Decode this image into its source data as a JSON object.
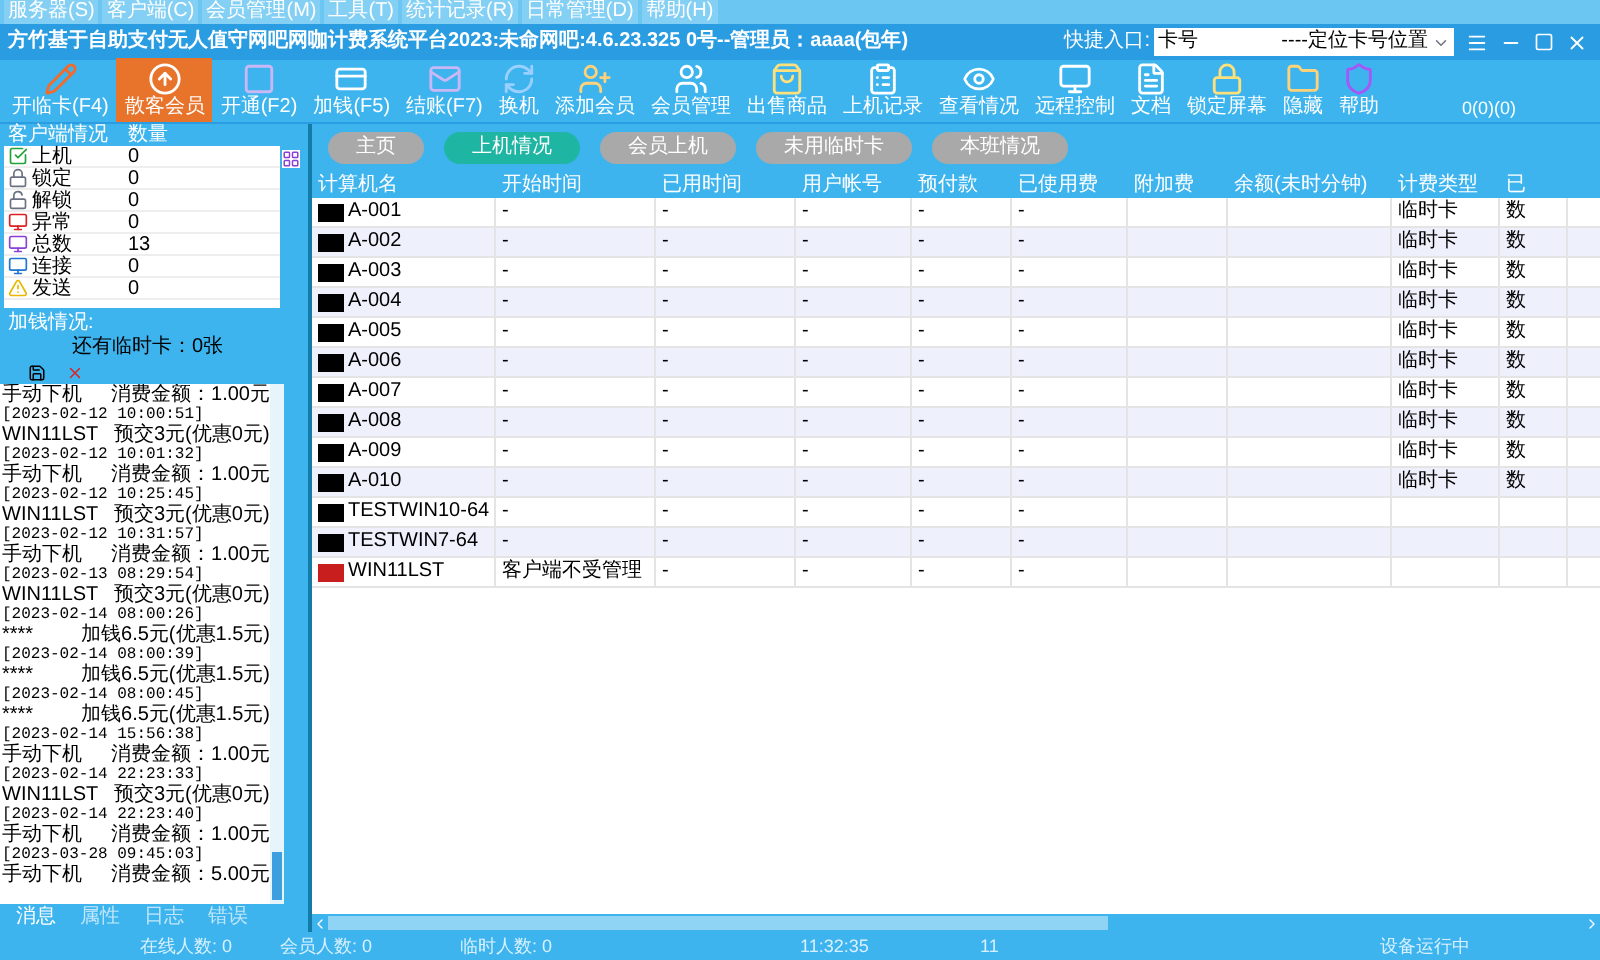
{
  "menu": [
    "服务器(S)",
    "客户端(C)",
    "会员管理(M)",
    "工具(T)",
    "统计记录(R)",
    "日常管理(D)",
    "帮助(H)"
  ],
  "window": {
    "title": "方竹基于自助支付无人值守网吧网咖计费系统平台2023:未命网吧:4.6.23.325 0号--管理员：aaaa(包年)"
  },
  "quick_entry": {
    "label": "快捷入口:",
    "value": "卡号",
    "option": "----定位卡号位置"
  },
  "toolbar": [
    {
      "label": "开临卡(F4)",
      "selected": false
    },
    {
      "label": "散客会员",
      "selected": true
    },
    {
      "label": "开通(F2)",
      "selected": false
    },
    {
      "label": "加钱(F5)",
      "selected": false
    },
    {
      "label": "结账(F7)",
      "selected": false
    },
    {
      "label": "换机",
      "selected": false
    },
    {
      "label": "添加会员",
      "selected": false
    },
    {
      "label": "会员管理",
      "selected": false
    },
    {
      "label": "出售商品",
      "selected": false
    },
    {
      "label": "上机记录",
      "selected": false
    },
    {
      "label": "查看情况",
      "selected": false
    },
    {
      "label": "远程控制",
      "selected": false
    },
    {
      "label": "文档",
      "selected": false
    },
    {
      "label": "锁定屏幕",
      "selected": false
    },
    {
      "label": "隐藏",
      "selected": false
    },
    {
      "label": "帮助",
      "selected": false
    }
  ],
  "toolbar_counter": "0(0)(0)",
  "client_status": {
    "columns": [
      "客户端情况",
      "数量"
    ],
    "rows": [
      {
        "kind": "online",
        "label": "上机",
        "count": "0"
      },
      {
        "kind": "locked",
        "label": "锁定",
        "count": "0"
      },
      {
        "kind": "unlocked",
        "label": "解锁",
        "count": "0"
      },
      {
        "kind": "error",
        "label": "异常",
        "count": "0"
      },
      {
        "kind": "total",
        "label": "总数",
        "count": "13"
      },
      {
        "kind": "connected",
        "label": "连接",
        "count": "0"
      },
      {
        "kind": "sent",
        "label": "发送",
        "count": "0"
      }
    ]
  },
  "topup_label": "加钱情况:",
  "temp_cards": "还有临时卡：0张",
  "log": [
    {
      "source": "手动下机",
      "message": "消费金额：1.00元"
    },
    {
      "time": "[2023-02-12 10:00:51]",
      "source": "WIN11LST",
      "message": "预交3元(优惠0元)"
    },
    {
      "time": "[2023-02-12 10:01:32]",
      "source": "手动下机",
      "message": "消费金额：1.00元"
    },
    {
      "time": "[2023-02-12 10:25:45]",
      "source": "WIN11LST",
      "message": "预交3元(优惠0元)"
    },
    {
      "time": "[2023-02-12 10:31:57]",
      "source": "手动下机",
      "message": "消费金额：1.00元"
    },
    {
      "time": "[2023-02-13 08:29:54]",
      "source": "WIN11LST",
      "message": "预交3元(优惠0元)"
    },
    {
      "time": "[2023-02-14 08:00:26]",
      "source": "****",
      "message": "加钱6.5元(优惠1.5元)"
    },
    {
      "time": "[2023-02-14 08:00:39]",
      "source": "****",
      "message": "加钱6.5元(优惠1.5元)"
    },
    {
      "time": "[2023-02-14 08:00:45]",
      "source": "****",
      "message": "加钱6.5元(优惠1.5元)"
    },
    {
      "time": "[2023-02-14 15:56:38]",
      "source": "手动下机",
      "message": "消费金额：1.00元"
    },
    {
      "time": "[2023-02-14 22:23:33]",
      "source": "WIN11LST",
      "message": "预交3元(优惠0元)"
    },
    {
      "time": "[2023-02-14 22:23:40]",
      "source": "手动下机",
      "message": "消费金额：1.00元"
    },
    {
      "time": "[2023-03-28 09:45:03]",
      "source": "手动下机",
      "message": "消费金额：5.00元"
    }
  ],
  "log_tabs": [
    {
      "label": "消息",
      "selected": true
    },
    {
      "label": "属性",
      "selected": false
    },
    {
      "label": "日志",
      "selected": false
    },
    {
      "label": "错误",
      "selected": false
    }
  ],
  "view_tabs": [
    {
      "label": "主页",
      "selected": false
    },
    {
      "label": "上机情况",
      "selected": true
    },
    {
      "label": "会员上机",
      "selected": false
    },
    {
      "label": "未用临时卡",
      "selected": false
    },
    {
      "label": "本班情况",
      "selected": false
    }
  ],
  "table": {
    "columns": [
      "计算机名",
      "开始时间",
      "已用时间",
      "用户帐号",
      "预付款",
      "已使用费",
      "附加费",
      "余额(未时分钟)",
      "计费类型",
      "已"
    ],
    "rows": [
      {
        "kind": "managed",
        "cells": [
          "A-001",
          "-",
          "-",
          "-",
          "-",
          "-",
          null,
          null,
          "临时卡",
          "数"
        ]
      },
      {
        "kind": "managed",
        "cells": [
          "A-002",
          "-",
          "-",
          "-",
          "-",
          "-",
          null,
          null,
          "临时卡",
          "数"
        ]
      },
      {
        "kind": "managed",
        "cells": [
          "A-003",
          "-",
          "-",
          "-",
          "-",
          "-",
          null,
          null,
          "临时卡",
          "数"
        ]
      },
      {
        "kind": "managed",
        "cells": [
          "A-004",
          "-",
          "-",
          "-",
          "-",
          "-",
          null,
          null,
          "临时卡",
          "数"
        ]
      },
      {
        "kind": "managed",
        "cells": [
          "A-005",
          "-",
          "-",
          "-",
          "-",
          "-",
          null,
          null,
          "临时卡",
          "数"
        ]
      },
      {
        "kind": "managed",
        "cells": [
          "A-006",
          "-",
          "-",
          "-",
          "-",
          "-",
          null,
          null,
          "临时卡",
          "数"
        ]
      },
      {
        "kind": "managed",
        "cells": [
          "A-007",
          "-",
          "-",
          "-",
          "-",
          "-",
          null,
          null,
          "临时卡",
          "数"
        ]
      },
      {
        "kind": "managed",
        "cells": [
          "A-008",
          "-",
          "-",
          "-",
          "-",
          "-",
          null,
          null,
          "临时卡",
          "数"
        ]
      },
      {
        "kind": "managed",
        "cells": [
          "A-009",
          "-",
          "-",
          "-",
          "-",
          "-",
          null,
          null,
          "临时卡",
          "数"
        ]
      },
      {
        "kind": "managed",
        "cells": [
          "A-010",
          "-",
          "-",
          "-",
          "-",
          "-",
          null,
          null,
          "临时卡",
          "数"
        ]
      },
      {
        "kind": "managed",
        "cells": [
          "TESTWIN10-64",
          "-",
          "-",
          "-",
          "-",
          "-",
          null,
          null,
          null,
          null
        ]
      },
      {
        "kind": "managed",
        "cells": [
          "TESTWIN7-64",
          "-",
          "-",
          "-",
          "-",
          "-",
          null,
          null,
          null,
          null
        ]
      },
      {
        "kind": "unmanaged",
        "cells": [
          "WIN11LST",
          "客户端不受管理",
          "-",
          "-",
          "-",
          "-",
          null,
          null,
          null,
          null
        ]
      }
    ]
  },
  "status_bar": [
    "在线人数: 0",
    "会员人数: 0",
    "临时人数: 0",
    "11:32:35",
    "11",
    "设备运行中"
  ]
}
